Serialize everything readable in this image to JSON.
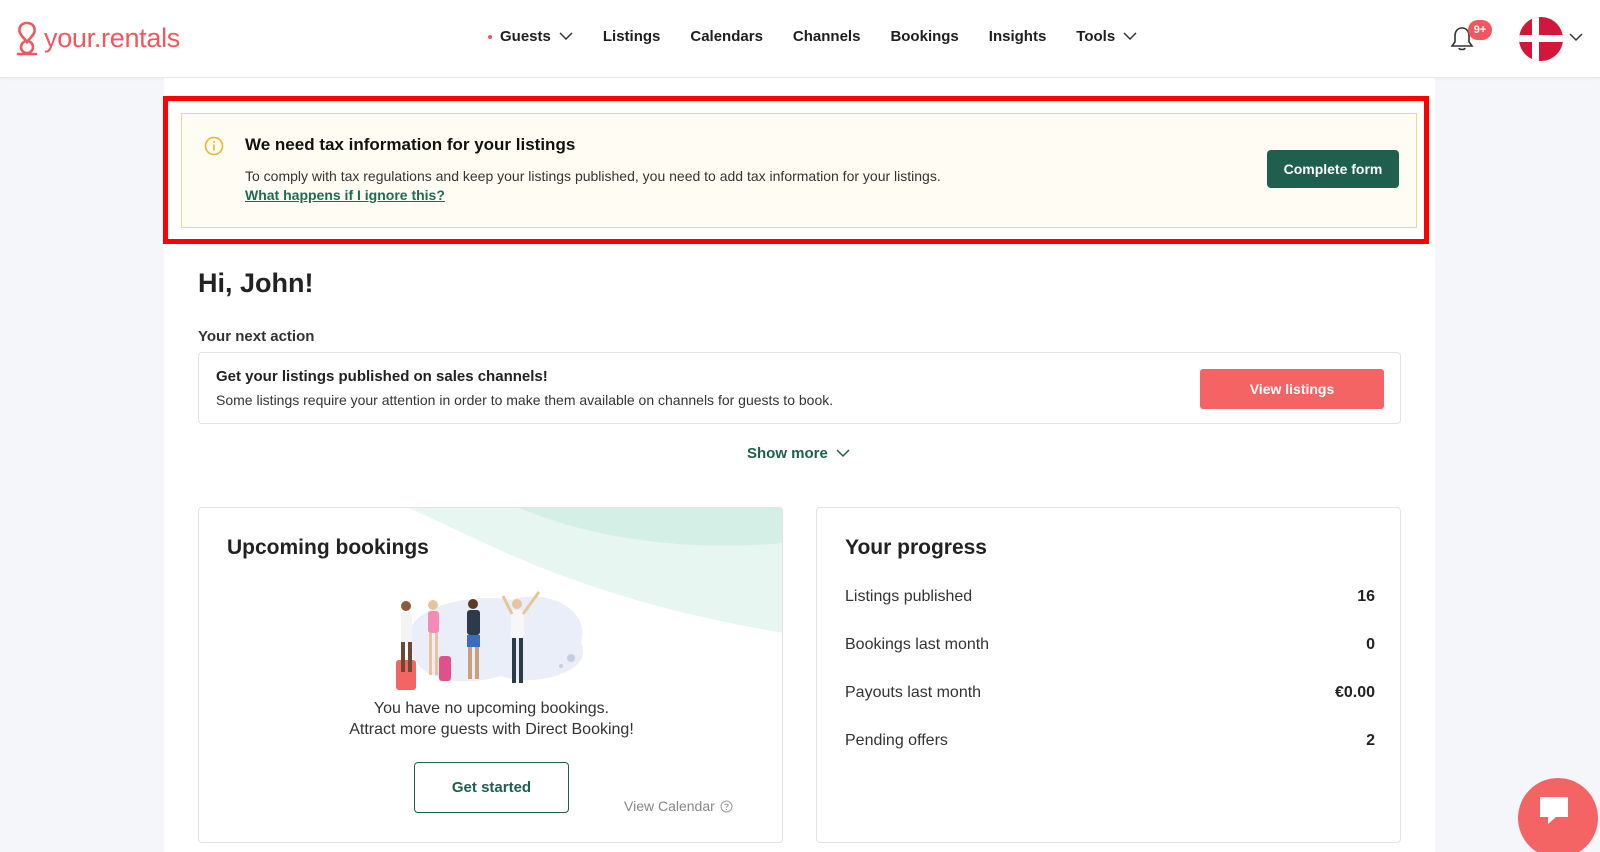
{
  "header": {
    "logo_text": "your.rentals",
    "nav": [
      {
        "label": "Guests",
        "has_dot": true,
        "has_chevron": true
      },
      {
        "label": "Listings"
      },
      {
        "label": "Calendars"
      },
      {
        "label": "Channels"
      },
      {
        "label": "Bookings"
      },
      {
        "label": "Insights"
      },
      {
        "label": "Tools",
        "has_chevron": true
      }
    ],
    "notification_badge": "9+",
    "language_flag": "denmark-flag-icon"
  },
  "tax_banner": {
    "title": "We need tax information for your listings",
    "description": "To comply with tax regulations and keep your listings published, you need to add tax information for your listings.",
    "link": "What happens if I ignore this?",
    "button": "Complete form",
    "icon": "info-icon"
  },
  "greeting": "Hi, John!",
  "next_action": {
    "label": "Your next action",
    "title": "Get your listings published on sales channels!",
    "description": "Some listings require your attention in order to make them available on channels for guests to book.",
    "button": "View listings"
  },
  "show_more": "Show more",
  "upcoming": {
    "title": "Upcoming bookings",
    "line1": "You have no upcoming bookings.",
    "line2": "Attract more guests with Direct Booking!",
    "button": "Get started",
    "view_calendar": "View Calendar"
  },
  "progress": {
    "title": "Your progress",
    "rows": [
      {
        "label": "Listings published",
        "value": "16"
      },
      {
        "label": "Bookings last month",
        "value": "0"
      },
      {
        "label": "Payouts last month",
        "value": "€0.00"
      },
      {
        "label": "Pending offers",
        "value": "2"
      }
    ]
  },
  "colors": {
    "brand": "#f0575f",
    "primary_green": "#1e5f4e",
    "highlight_red": "#ff0000"
  }
}
